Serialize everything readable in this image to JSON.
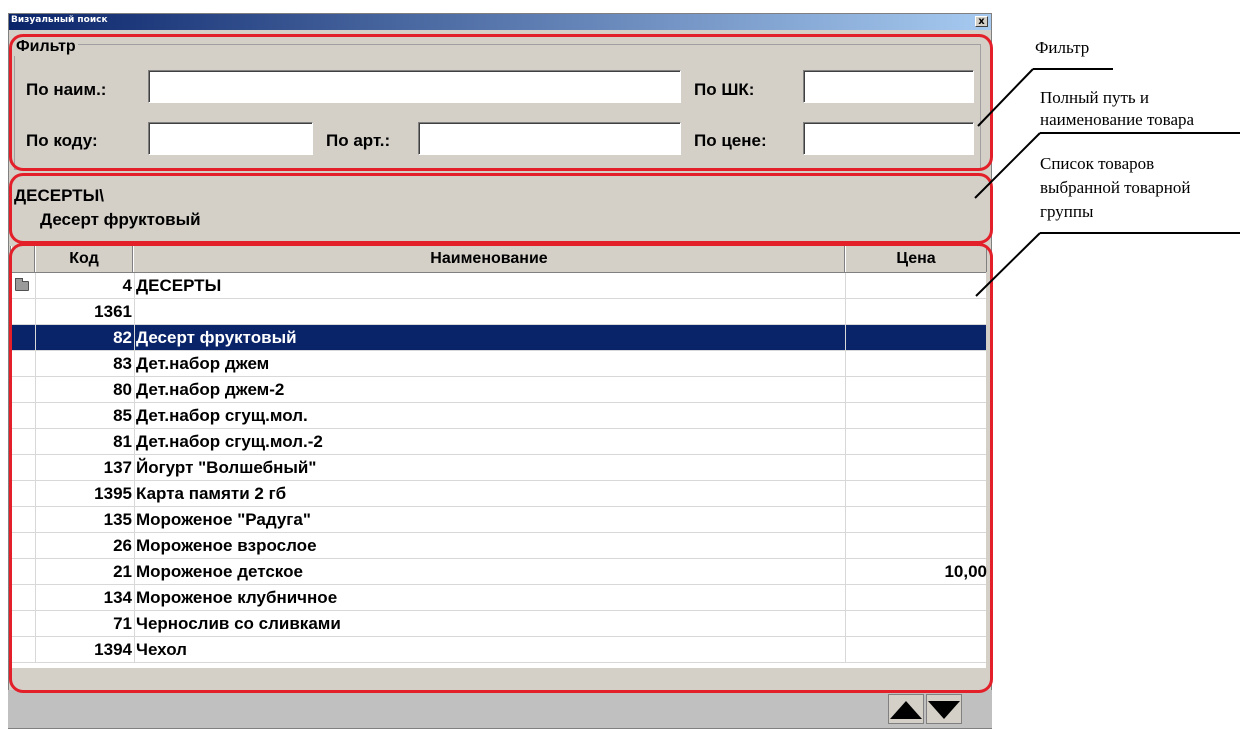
{
  "window": {
    "title": "Визуальный поиск",
    "close_label": "x"
  },
  "filter": {
    "legend": "Фильтр",
    "by_name_label": "По наим.:",
    "by_barcode_label": "По ШК:",
    "by_code_label": "По коду:",
    "by_article_label": "По арт.:",
    "by_price_label": "По цене:",
    "by_name_value": "",
    "by_barcode_value": "",
    "by_code_value": "",
    "by_article_value": "",
    "by_price_value": ""
  },
  "path": {
    "group": "ДЕСЕРТЫ\\",
    "item": "Десерт фруктовый"
  },
  "grid": {
    "columns": [
      "Код",
      "Наименование",
      "Цена"
    ],
    "rows": [
      {
        "code": "4",
        "name": "ДЕСЕРТЫ",
        "price": "",
        "folder": true
      },
      {
        "code": "1361",
        "name": "",
        "price": ""
      },
      {
        "code": "82",
        "name": "Десерт фруктовый",
        "price": "",
        "selected": true
      },
      {
        "code": "83",
        "name": "Дет.набор джем",
        "price": ""
      },
      {
        "code": "80",
        "name": "Дет.набор джем-2",
        "price": ""
      },
      {
        "code": "85",
        "name": "Дет.набор сгущ.мол.",
        "price": ""
      },
      {
        "code": "81",
        "name": "Дет.набор сгущ.мол.-2",
        "price": ""
      },
      {
        "code": "137",
        "name": "Йогурт \"Волшебный\"",
        "price": ""
      },
      {
        "code": "1395",
        "name": "Карта памяти 2 гб",
        "price": ""
      },
      {
        "code": "135",
        "name": "Мороженое \"Радуга\"",
        "price": ""
      },
      {
        "code": "26",
        "name": "Мороженое взрослое",
        "price": ""
      },
      {
        "code": "21",
        "name": "Мороженое детское",
        "price": "10,00"
      },
      {
        "code": "134",
        "name": "Мороженое клубничное",
        "price": ""
      },
      {
        "code": "71",
        "name": "Чернослив со сливками",
        "price": ""
      },
      {
        "code": "1394",
        "name": "Чехол",
        "price": ""
      }
    ]
  },
  "annotations": {
    "filter": "Фильтр",
    "path_line1": "Полный путь и",
    "path_line2": "наименование товара",
    "list_line1": "Список товаров",
    "list_line2": "выбранной товарной",
    "list_line3": "группы"
  },
  "colors": {
    "selection": "#0a246a",
    "annotation_outline": "#e3202a",
    "window_bg": "#d4d0c8"
  }
}
